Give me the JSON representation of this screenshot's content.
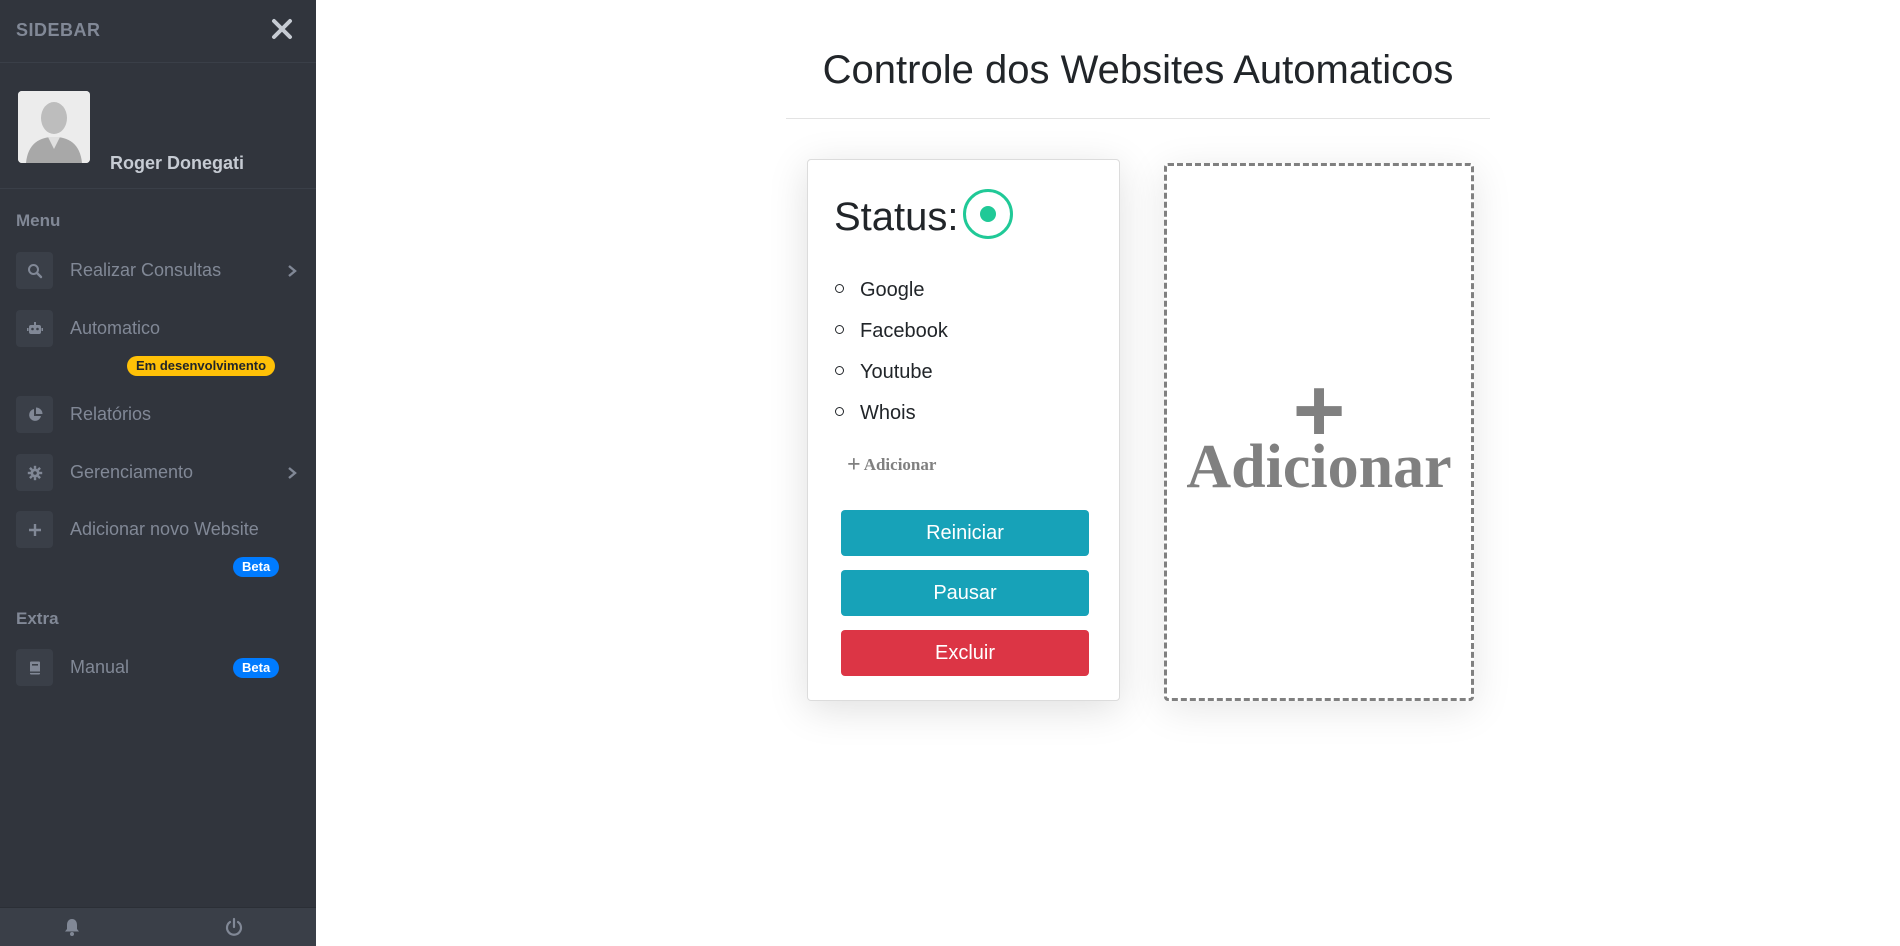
{
  "sidebar": {
    "brand": "SIDEBAR",
    "user": {
      "name": "Roger Donegati"
    },
    "sections": {
      "menu": "Menu",
      "extra": "Extra"
    },
    "items": [
      {
        "label": "Realizar Consultas",
        "icon": "search-icon"
      },
      {
        "label": "Automatico",
        "icon": "robot-icon",
        "badge": "Em desenvolvimento"
      },
      {
        "label": "Relatórios",
        "icon": "pie-chart-icon"
      },
      {
        "label": "Gerenciamento",
        "icon": "gear-icon"
      },
      {
        "label": "Adicionar novo Website",
        "icon": "plus-icon",
        "badge": "Beta"
      }
    ],
    "extra_items": [
      {
        "label": "Manual",
        "icon": "book-icon",
        "badge": "Beta"
      }
    ],
    "colors": {
      "background": "#31353d",
      "text": "#818896",
      "badge_warning": "#ffc107",
      "badge_primary": "#007bff"
    }
  },
  "main": {
    "title": "Controle dos Websites Automaticos",
    "card": {
      "status_label": "Status:",
      "status_color": "#20c997",
      "sites": [
        "Google",
        "Facebook",
        "Youtube",
        "Whois"
      ],
      "add_label": "Adicionar",
      "buttons": {
        "restart": "Reiniciar",
        "pause": "Pausar",
        "delete": "Excluir"
      }
    },
    "add_card": {
      "plus": "+",
      "label": "Adicionar"
    },
    "colors": {
      "info": "#17a2b8",
      "danger": "#dc3545"
    }
  }
}
